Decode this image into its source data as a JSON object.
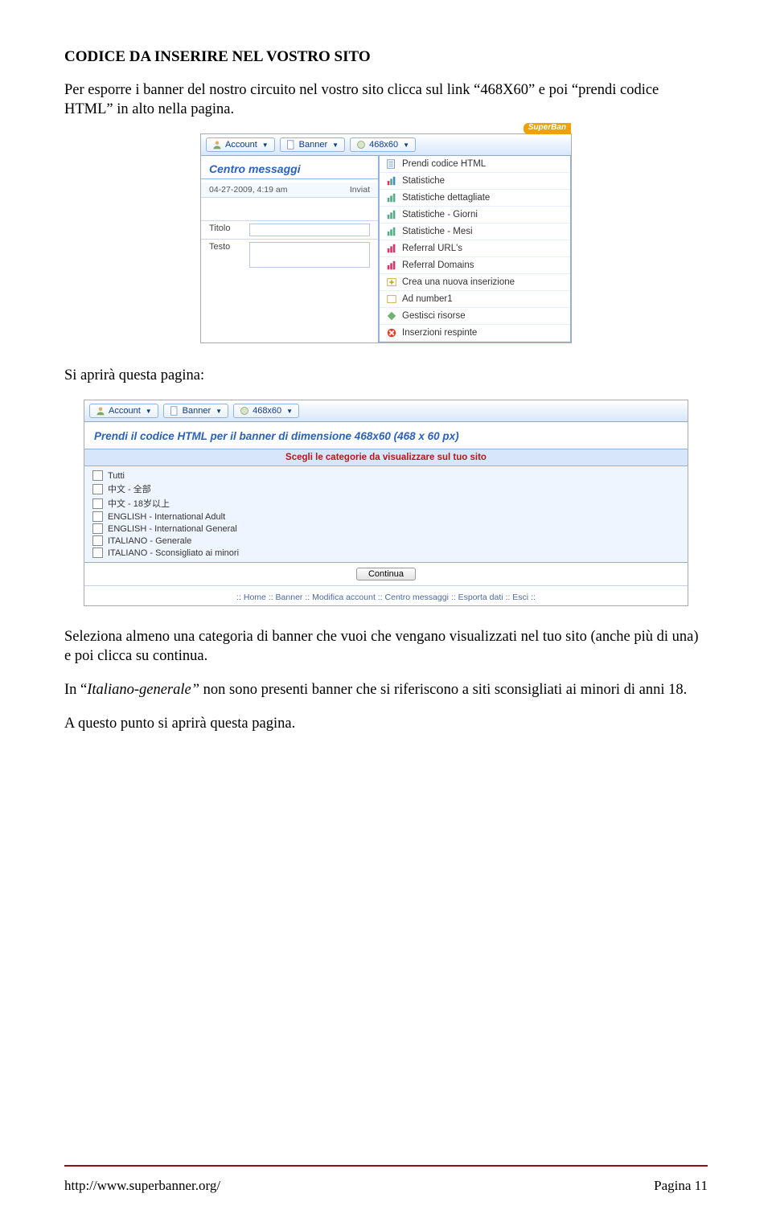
{
  "heading": "CODICE DA INSERIRE NEL VOSTRO SITO",
  "intro_html": "Per esporre i banner del nostro circuito nel vostro sito clicca sul link “468X60” e poi “prendi codice HTML” in alto nella pagina.",
  "screenshot1": {
    "superban": "SuperBan",
    "toolbar": {
      "account": "Account",
      "banner": "Banner",
      "size": "468x60"
    },
    "centro_messaggi": "Centro messaggi",
    "msg_date": "04-27-2009, 4:19 am",
    "msg_inviat": "Inviat",
    "titolo_label": "Titolo",
    "testo_label": "Testo",
    "menu_items": [
      "Prendi codice HTML",
      "Statistiche",
      "Statistiche dettagliate",
      "Statistiche - Giorni",
      "Statistiche - Mesi",
      "Referral URL's",
      "Referral Domains",
      "Crea una nuova inserizione",
      "Ad number1",
      "Gestisci risorse",
      "Inserzioni respinte"
    ]
  },
  "mid_text": "Si aprirà questa pagina:",
  "screenshot2": {
    "toolbar": {
      "account": "Account",
      "banner": "Banner",
      "size": "468x60"
    },
    "section_title": "Prendi il codice HTML per il banner di dimensione 468x60 (468 x 60 px)",
    "grid_header": "Scegli le categorie da visualizzare sul tuo sito",
    "categories": [
      "Tutti",
      "中文 - 全部",
      "中文 - 18岁以上",
      "ENGLISH - International Adult",
      "ENGLISH - International General",
      "ITALIANO - Generale",
      "ITALIANO - Sconsigliato ai minori"
    ],
    "continua": "Continua",
    "footer_links": ":: Home :: Banner :: Modifica account :: Centro messaggi :: Esporta dati :: Esci ::"
  },
  "para_after_shot2": "Seleziona almeno una categoria di banner che vuoi che vengano visualizzati nel tuo sito (anche più di una) e poi clicca su continua.",
  "para_italic_prefix": "In “",
  "para_italic": "Italiano-generale” ",
  "para_italic_rest": "non sono presenti banner che si riferiscono a siti sconsigliati ai minori di anni 18.",
  "para_final": "A questo punto si aprirà questa pagina.",
  "footer_url": "http://www.superbanner.org/",
  "footer_page": "Pagina 11"
}
